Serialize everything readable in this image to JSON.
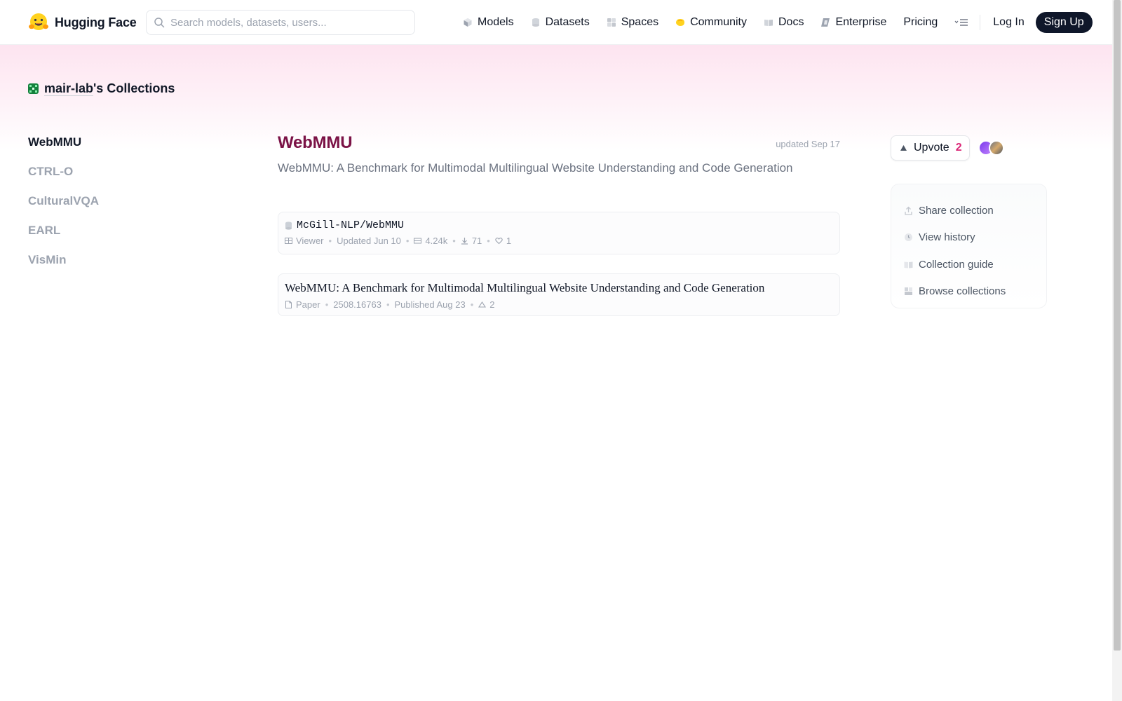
{
  "header": {
    "brand_name": "Hugging Face",
    "search_placeholder": "Search models, datasets, users...",
    "nav": [
      {
        "label": "Models",
        "icon": "models-icon"
      },
      {
        "label": "Datasets",
        "icon": "datasets-icon"
      },
      {
        "label": "Spaces",
        "icon": "spaces-icon"
      },
      {
        "label": "Community",
        "icon": "community-icon"
      },
      {
        "label": "Docs",
        "icon": "docs-icon"
      },
      {
        "label": "Enterprise",
        "icon": "enterprise-icon"
      },
      {
        "label": "Pricing",
        "icon": ""
      }
    ],
    "login_label": "Log In",
    "signup_label": "Sign Up"
  },
  "owner": {
    "name": "mair-lab",
    "suffix": "'s Collections"
  },
  "sidebar": {
    "items": [
      {
        "label": "WebMMU",
        "active": true
      },
      {
        "label": "CTRL-O",
        "active": false
      },
      {
        "label": "CulturalVQA",
        "active": false
      },
      {
        "label": "EARL",
        "active": false
      },
      {
        "label": "VisMin",
        "active": false
      }
    ]
  },
  "collection": {
    "title": "WebMMU",
    "updated": "updated Sep 17",
    "description": "WebMMU: A Benchmark for Multimodal Multilingual Website Understanding and Code Generation",
    "items": [
      {
        "type": "dataset",
        "title": "McGill-NLP/WebMMU",
        "meta": [
          "Viewer",
          "Updated Jun 10",
          "4.24k",
          "71",
          "1"
        ]
      },
      {
        "type": "paper",
        "title": "WebMMU: A Benchmark for Multimodal Multilingual Website Understanding and Code Generation",
        "meta": [
          "Paper",
          "2508.16763",
          "Published Aug 23",
          "2"
        ]
      }
    ]
  },
  "upvote": {
    "label": "Upvote",
    "count": "2"
  },
  "actions": [
    {
      "label": "Share collection",
      "icon": "share-icon"
    },
    {
      "label": "View history",
      "icon": "history-icon"
    },
    {
      "label": "Collection guide",
      "icon": "guide-icon"
    },
    {
      "label": "Browse collections",
      "icon": "browse-icon"
    }
  ],
  "colors": {
    "title": "#7b1246",
    "upvote_count": "#db2777",
    "signup_bg": "#0f172a",
    "hero_pink": "#fde4f0"
  }
}
